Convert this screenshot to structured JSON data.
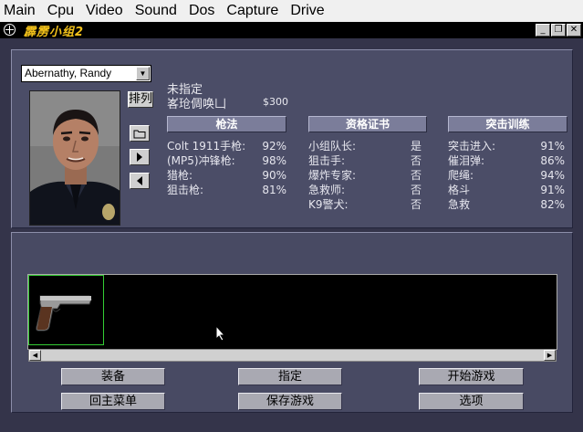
{
  "menubar": {
    "items": [
      "Main",
      "Cpu",
      "Video",
      "Sound",
      "Dos",
      "Capture",
      "Drive"
    ]
  },
  "titlebar": {
    "logo": "霹雳小组2"
  },
  "agent": {
    "selected": "Abernathy, Randy",
    "status": "未指定",
    "name_line": "峉玱倜唤凵",
    "salary": "$300"
  },
  "buttons": {
    "sort": "排列",
    "equip": "装备",
    "assign": "指定",
    "start_game": "开始游戏",
    "main_menu": "回主菜单",
    "save_game": "保存游戏",
    "options": "选项"
  },
  "sections": {
    "weapons": {
      "title": "枪法",
      "rows": [
        {
          "label": "Colt 1911手枪:",
          "value": "92%"
        },
        {
          "label": "(MP5)冲锋枪:",
          "value": "98%"
        },
        {
          "label": "猎枪:",
          "value": "90%"
        },
        {
          "label": "狙击枪:",
          "value": "81%"
        }
      ]
    },
    "certifications": {
      "title": "资格证书",
      "rows": [
        {
          "label": "小组队长:",
          "value": "是"
        },
        {
          "label": "狙击手:",
          "value": "否"
        },
        {
          "label": "爆炸专家:",
          "value": "否"
        },
        {
          "label": "急救师:",
          "value": "否"
        },
        {
          "label": "K9警犬:",
          "value": "否"
        }
      ]
    },
    "training": {
      "title": "突击训练",
      "rows": [
        {
          "label": "突击进入:",
          "value": "91%"
        },
        {
          "label": "催泪弹:",
          "value": "86%"
        },
        {
          "label": "爬绳:",
          "value": "94%"
        },
        {
          "label": "格斗",
          "value": "91%"
        },
        {
          "label": "急救",
          "value": "82%"
        }
      ]
    }
  },
  "inventory": {
    "items": [
      "pistol-icon"
    ]
  }
}
